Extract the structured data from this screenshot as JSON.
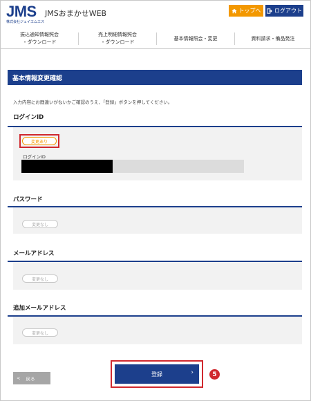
{
  "header": {
    "logo_text": "JMS",
    "logo_subtext": "株式会社ジェイエムエス",
    "app_title": "JMSおまかせWEB",
    "top_button": "トップへ",
    "logout_button": "ログアウト"
  },
  "nav": {
    "items": [
      {
        "line1": "振込通知情報照会",
        "line2": "・ダウンロード"
      },
      {
        "line1": "売上明細情報照会",
        "line2": "・ダウンロード"
      },
      {
        "line1": "基本情報照会・変更",
        "line2": ""
      },
      {
        "line1": "資料請求・備品発注",
        "line2": ""
      }
    ]
  },
  "page": {
    "title": "基本情報変更確認",
    "instruction": "入力内容にお間違いがないかご確認のうえ、「登録」ボタンを押してください。"
  },
  "sections": {
    "login": {
      "heading": "ログインID",
      "badge": "変更あり",
      "field_label": "ログインID"
    },
    "password": {
      "heading": "パスワード",
      "badge": "変更なし"
    },
    "email": {
      "heading": "メールアドレス",
      "badge": "変更なし"
    },
    "additional_email": {
      "heading": "追加メールアドレス",
      "badge": "変更なし"
    }
  },
  "actions": {
    "back": "戻る",
    "back_arrow": "<",
    "register": "登録",
    "register_arrow": "›",
    "step_number": "5"
  },
  "colors": {
    "brand_blue": "#1c3f8c",
    "accent_orange": "#f39800",
    "highlight_red": "#d0282e"
  }
}
